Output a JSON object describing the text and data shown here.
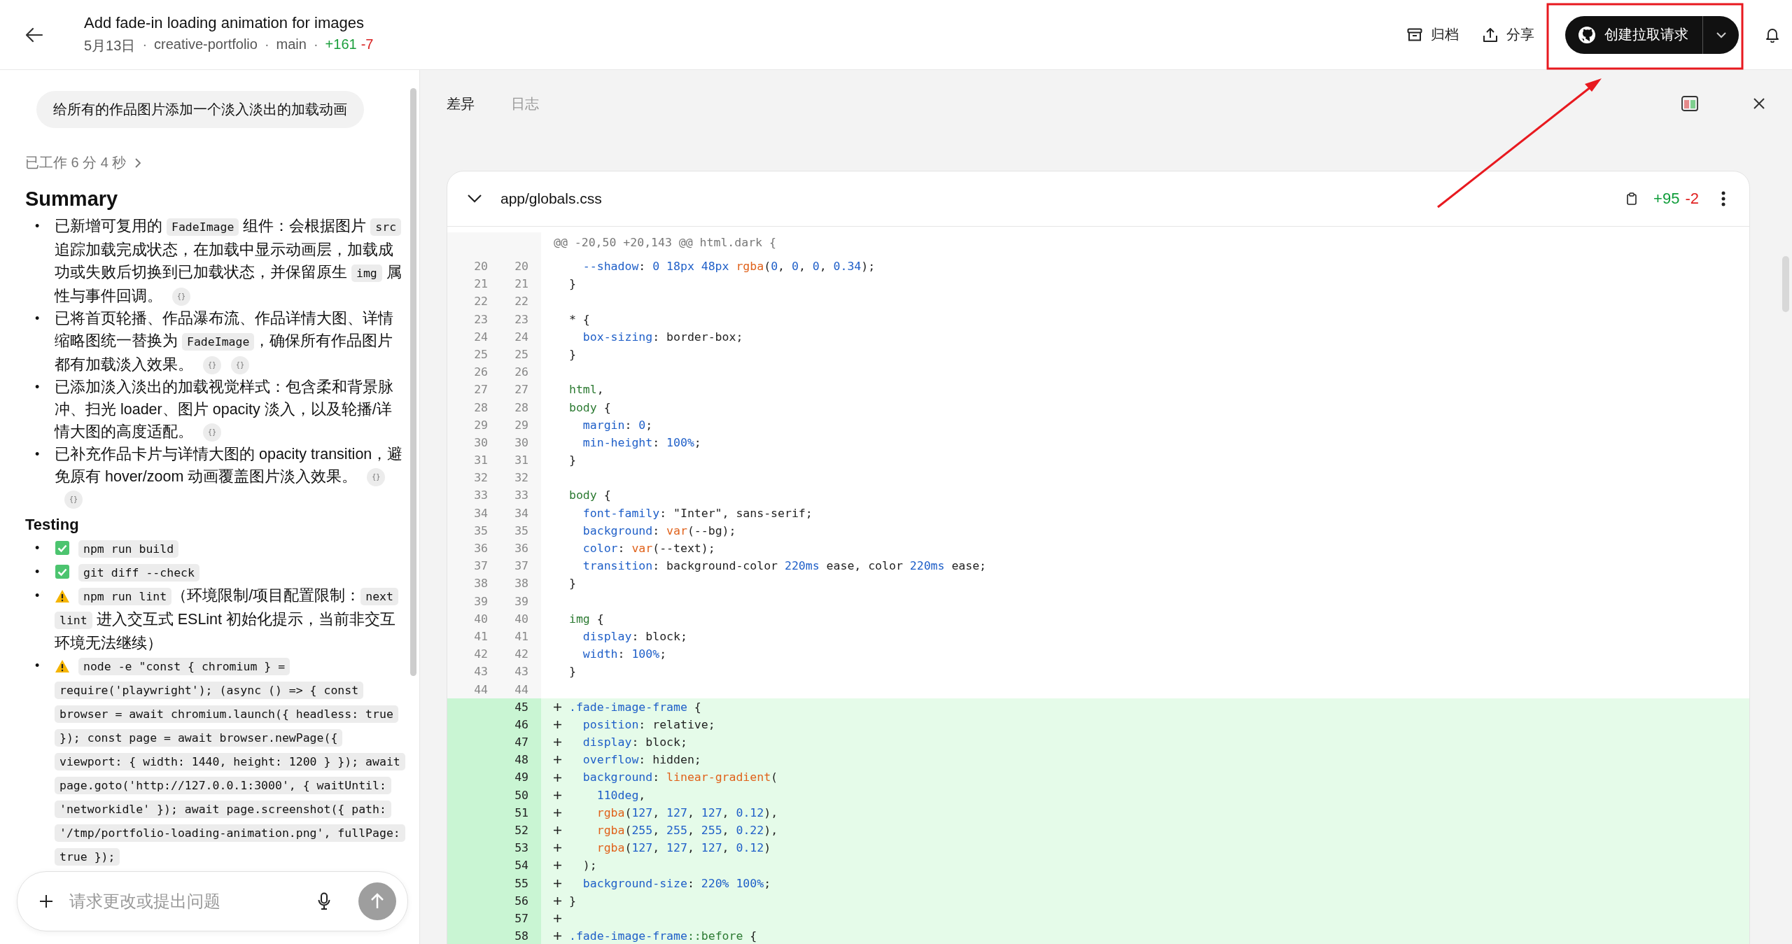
{
  "header": {
    "title": "Add fade-in loading animation for images",
    "meta": [
      {
        "kind": "text",
        "text": "5月13日"
      },
      {
        "kind": "sep",
        "text": "·"
      },
      {
        "kind": "text",
        "text": "creative-portfolio"
      },
      {
        "kind": "sep",
        "text": "·"
      },
      {
        "kind": "text",
        "text": "main"
      },
      {
        "kind": "sep",
        "text": "·"
      },
      {
        "kind": "add",
        "text": "+161"
      },
      {
        "kind": "del",
        "text": "-7"
      }
    ],
    "actions": [
      {
        "kind": "archive",
        "label": "归档"
      },
      {
        "kind": "share",
        "label": "分享"
      }
    ],
    "primary_action": {
      "label": "创建拉取请求"
    }
  },
  "conversation": {
    "prompt": "给所有的作品图片添加一个淡入淡出的加载动画",
    "worked": "已工作 6 分 4 秒",
    "summary": {
      "heading": "Summary",
      "items": [
        {
          "bullet": "•",
          "segments": [
            {
              "kind": "text",
              "text": "已新增可复用的 "
            },
            {
              "kind": "code",
              "text": "FadeImage"
            },
            {
              "kind": "text",
              "text": " 组件：会根据图片 "
            },
            {
              "kind": "code",
              "text": "src"
            },
            {
              "kind": "text",
              "text": " 追踪加载完成状态，在加载中显示动画层，加载成功或失败后切换到已加载状态，并保留原生 "
            },
            {
              "kind": "code",
              "text": "img"
            },
            {
              "kind": "text",
              "text": " 属性与事件回调。"
            },
            {
              "kind": "ref",
              "text": "{}"
            }
          ]
        },
        {
          "bullet": "•",
          "segments": [
            {
              "kind": "text",
              "text": "已将首页轮播、作品瀑布流、作品详情大图、详情缩略图统一替换为 "
            },
            {
              "kind": "code",
              "text": "FadeImage"
            },
            {
              "kind": "text",
              "text": "，确保所有作品图片都有加载淡入效果。"
            },
            {
              "kind": "ref",
              "text": "{}"
            },
            {
              "kind": "ref",
              "text": "{}"
            }
          ]
        },
        {
          "bullet": "•",
          "segments": [
            {
              "kind": "text",
              "text": "已添加淡入淡出的加载视觉样式：包含柔和背景脉冲、扫光 loader、图片 opacity 淡入，以及轮播/详情大图的高度适配。"
            },
            {
              "kind": "ref",
              "text": "{}"
            }
          ]
        },
        {
          "bullet": "•",
          "segments": [
            {
              "kind": "text",
              "text": "已补充作品卡片与详情大图的 opacity transition，避免原有 hover/zoom 动画覆盖图片淡入效果。"
            },
            {
              "kind": "ref",
              "text": "{}"
            },
            {
              "kind": "ref",
              "text": "{}"
            }
          ]
        }
      ]
    },
    "testing": {
      "heading": "Testing",
      "items": [
        {
          "bullet": "•",
          "kind": "passed",
          "segments": [
            {
              "kind": "code",
              "text": "npm run build"
            }
          ]
        },
        {
          "bullet": "•",
          "kind": "passed",
          "segments": [
            {
              "kind": "code",
              "text": "git diff --check"
            }
          ]
        },
        {
          "bullet": "•",
          "kind": "warning",
          "segments": [
            {
              "kind": "code",
              "text": "npm run lint"
            },
            {
              "kind": "text",
              "text": "（环境限制/项目配置限制："
            },
            {
              "kind": "code",
              "text": "next lint"
            },
            {
              "kind": "text",
              "text": " 进入交互式 ESLint 初始化提示，当前非交互环境无法继续）"
            }
          ]
        },
        {
          "bullet": "•",
          "kind": "warning",
          "segments": [
            {
              "kind": "code",
              "text": "node -e \"const { chromium } = require('playwright'); (async () => { const browser = await chromium.launch({ headless: true }); const page = await browser.newPage({ viewport: { width: 1440, height: 1200 } }); await page.goto('http://127.0.0.1:3000', { waitUntil: 'networkidle' }); await page.screenshot({ path: '/tmp/portfolio-loading-animation.png', fullPage: true });"
            }
          ]
        }
      ]
    }
  },
  "composer": {
    "placeholder": "请求更改或提出问题"
  },
  "diff_panel": {
    "tabs": [
      {
        "label": "差异",
        "selected": true
      },
      {
        "label": "日志",
        "selected": false
      }
    ],
    "file": {
      "path": "app/globals.css",
      "expanded": true,
      "additions": "+95",
      "deletions": "-2",
      "lines": [
        {
          "kind": "hunk",
          "tokens": [
            {
              "kind": "hunk",
              "text": "@@ -20,50 +20,143 @@ html.dark {"
            }
          ]
        },
        {
          "kind": "context",
          "old": "20",
          "new": "20",
          "tokens": [
            {
              "kind": "prop",
              "text": "  --shadow"
            },
            {
              "kind": "plain",
              "text": ": "
            },
            {
              "kind": "num",
              "text": "0 18px 48px "
            },
            {
              "kind": "func",
              "text": "rgba"
            },
            {
              "kind": "plain",
              "text": "("
            },
            {
              "kind": "num",
              "text": "0"
            },
            {
              "kind": "plain",
              "text": ", "
            },
            {
              "kind": "num",
              "text": "0"
            },
            {
              "kind": "plain",
              "text": ", "
            },
            {
              "kind": "num",
              "text": "0"
            },
            {
              "kind": "plain",
              "text": ", "
            },
            {
              "kind": "num",
              "text": "0.34"
            },
            {
              "kind": "plain",
              "text": ");"
            }
          ]
        },
        {
          "kind": "context",
          "old": "21",
          "new": "21",
          "tokens": [
            {
              "kind": "plain",
              "text": "}"
            }
          ]
        },
        {
          "kind": "context",
          "old": "22",
          "new": "22"
        },
        {
          "kind": "context",
          "old": "23",
          "new": "23",
          "tokens": [
            {
              "kind": "plain",
              "text": "* {"
            }
          ]
        },
        {
          "kind": "context",
          "old": "24",
          "new": "24",
          "tokens": [
            {
              "kind": "prop",
              "text": "  box-sizing"
            },
            {
              "kind": "plain",
              "text": ": border-box;"
            }
          ]
        },
        {
          "kind": "context",
          "old": "25",
          "new": "25",
          "tokens": [
            {
              "kind": "plain",
              "text": "}"
            }
          ]
        },
        {
          "kind": "context",
          "old": "26",
          "new": "26"
        },
        {
          "kind": "context",
          "old": "27",
          "new": "27",
          "tokens": [
            {
              "kind": "tag",
              "text": "html"
            },
            {
              "kind": "plain",
              "text": ","
            }
          ]
        },
        {
          "kind": "context",
          "old": "28",
          "new": "28",
          "tokens": [
            {
              "kind": "tag",
              "text": "body"
            },
            {
              "kind": "plain",
              "text": " {"
            }
          ]
        },
        {
          "kind": "context",
          "old": "29",
          "new": "29",
          "tokens": [
            {
              "kind": "prop",
              "text": "  margin"
            },
            {
              "kind": "plain",
              "text": ": "
            },
            {
              "kind": "num",
              "text": "0"
            },
            {
              "kind": "plain",
              "text": ";"
            }
          ]
        },
        {
          "kind": "context",
          "old": "30",
          "new": "30",
          "tokens": [
            {
              "kind": "prop",
              "text": "  min-height"
            },
            {
              "kind": "plain",
              "text": ": "
            },
            {
              "kind": "num",
              "text": "100%"
            },
            {
              "kind": "plain",
              "text": ";"
            }
          ]
        },
        {
          "kind": "context",
          "old": "31",
          "new": "31",
          "tokens": [
            {
              "kind": "plain",
              "text": "}"
            }
          ]
        },
        {
          "kind": "context",
          "old": "32",
          "new": "32"
        },
        {
          "kind": "context",
          "old": "33",
          "new": "33",
          "tokens": [
            {
              "kind": "tag",
              "text": "body"
            },
            {
              "kind": "plain",
              "text": " {"
            }
          ]
        },
        {
          "kind": "context",
          "old": "34",
          "new": "34",
          "tokens": [
            {
              "kind": "prop",
              "text": "  font-family"
            },
            {
              "kind": "plain",
              "text": ": \"Inter\", sans-serif;"
            }
          ]
        },
        {
          "kind": "context",
          "old": "35",
          "new": "35",
          "tokens": [
            {
              "kind": "prop",
              "text": "  background"
            },
            {
              "kind": "plain",
              "text": ": "
            },
            {
              "kind": "func",
              "text": "var"
            },
            {
              "kind": "plain",
              "text": "(--bg);"
            }
          ]
        },
        {
          "kind": "context",
          "old": "36",
          "new": "36",
          "tokens": [
            {
              "kind": "prop",
              "text": "  color"
            },
            {
              "kind": "plain",
              "text": ": "
            },
            {
              "kind": "func",
              "text": "var"
            },
            {
              "kind": "plain",
              "text": "(--text);"
            }
          ]
        },
        {
          "kind": "context",
          "old": "37",
          "new": "37",
          "tokens": [
            {
              "kind": "prop",
              "text": "  transition"
            },
            {
              "kind": "plain",
              "text": ": background-color "
            },
            {
              "kind": "num",
              "text": "220ms"
            },
            {
              "kind": "plain",
              "text": " ease, color "
            },
            {
              "kind": "num",
              "text": "220ms"
            },
            {
              "kind": "plain",
              "text": " ease;"
            }
          ]
        },
        {
          "kind": "context",
          "old": "38",
          "new": "38",
          "tokens": [
            {
              "kind": "plain",
              "text": "}"
            }
          ]
        },
        {
          "kind": "context",
          "old": "39",
          "new": "39"
        },
        {
          "kind": "context",
          "old": "40",
          "new": "40",
          "tokens": [
            {
              "kind": "tag",
              "text": "img"
            },
            {
              "kind": "plain",
              "text": " {"
            }
          ]
        },
        {
          "kind": "context",
          "old": "41",
          "new": "41",
          "tokens": [
            {
              "kind": "prop",
              "text": "  display"
            },
            {
              "kind": "plain",
              "text": ": block;"
            }
          ]
        },
        {
          "kind": "context",
          "old": "42",
          "new": "42",
          "tokens": [
            {
              "kind": "prop",
              "text": "  width"
            },
            {
              "kind": "plain",
              "text": ": "
            },
            {
              "kind": "num",
              "text": "100%"
            },
            {
              "kind": "plain",
              "text": ";"
            }
          ]
        },
        {
          "kind": "context",
          "old": "43",
          "new": "43",
          "tokens": [
            {
              "kind": "plain",
              "text": "}"
            }
          ]
        },
        {
          "kind": "context",
          "old": "44",
          "new": "44"
        },
        {
          "kind": "added",
          "new": "45",
          "tokens": [
            {
              "kind": "prop",
              "text": ".fade-image-frame"
            },
            {
              "kind": "plain",
              "text": " {"
            }
          ]
        },
        {
          "kind": "added",
          "new": "46",
          "tokens": [
            {
              "kind": "prop",
              "text": "  position"
            },
            {
              "kind": "plain",
              "text": ": relative;"
            }
          ]
        },
        {
          "kind": "added",
          "new": "47",
          "tokens": [
            {
              "kind": "prop",
              "text": "  display"
            },
            {
              "kind": "plain",
              "text": ": block;"
            }
          ]
        },
        {
          "kind": "added",
          "new": "48",
          "tokens": [
            {
              "kind": "prop",
              "text": "  overflow"
            },
            {
              "kind": "plain",
              "text": ": hidden;"
            }
          ]
        },
        {
          "kind": "added",
          "new": "49",
          "tokens": [
            {
              "kind": "prop",
              "text": "  background"
            },
            {
              "kind": "plain",
              "text": ": "
            },
            {
              "kind": "func",
              "text": "linear-gradient"
            },
            {
              "kind": "plain",
              "text": "("
            }
          ]
        },
        {
          "kind": "added",
          "new": "50",
          "tokens": [
            {
              "kind": "num",
              "text": "    110deg"
            },
            {
              "kind": "plain",
              "text": ","
            }
          ]
        },
        {
          "kind": "added",
          "new": "51",
          "tokens": [
            {
              "kind": "func",
              "text": "    rgba"
            },
            {
              "kind": "plain",
              "text": "("
            },
            {
              "kind": "num",
              "text": "127"
            },
            {
              "kind": "plain",
              "text": ", "
            },
            {
              "kind": "num",
              "text": "127"
            },
            {
              "kind": "plain",
              "text": ", "
            },
            {
              "kind": "num",
              "text": "127"
            },
            {
              "kind": "plain",
              "text": ", "
            },
            {
              "kind": "num",
              "text": "0.12"
            },
            {
              "kind": "plain",
              "text": "),"
            }
          ]
        },
        {
          "kind": "added",
          "new": "52",
          "tokens": [
            {
              "kind": "func",
              "text": "    rgba"
            },
            {
              "kind": "plain",
              "text": "("
            },
            {
              "kind": "num",
              "text": "255"
            },
            {
              "kind": "plain",
              "text": ", "
            },
            {
              "kind": "num",
              "text": "255"
            },
            {
              "kind": "plain",
              "text": ", "
            },
            {
              "kind": "num",
              "text": "255"
            },
            {
              "kind": "plain",
              "text": ", "
            },
            {
              "kind": "num",
              "text": "0.22"
            },
            {
              "kind": "plain",
              "text": "),"
            }
          ]
        },
        {
          "kind": "added",
          "new": "53",
          "tokens": [
            {
              "kind": "func",
              "text": "    rgba"
            },
            {
              "kind": "plain",
              "text": "("
            },
            {
              "kind": "num",
              "text": "127"
            },
            {
              "kind": "plain",
              "text": ", "
            },
            {
              "kind": "num",
              "text": "127"
            },
            {
              "kind": "plain",
              "text": ", "
            },
            {
              "kind": "num",
              "text": "127"
            },
            {
              "kind": "plain",
              "text": ", "
            },
            {
              "kind": "num",
              "text": "0.12"
            },
            {
              "kind": "plain",
              "text": ")"
            }
          ]
        },
        {
          "kind": "added",
          "new": "54",
          "tokens": [
            {
              "kind": "plain",
              "text": "  );"
            }
          ]
        },
        {
          "kind": "added",
          "new": "55",
          "tokens": [
            {
              "kind": "prop",
              "text": "  background-size"
            },
            {
              "kind": "plain",
              "text": ": "
            },
            {
              "kind": "num",
              "text": "220% 100%"
            },
            {
              "kind": "plain",
              "text": ";"
            }
          ]
        },
        {
          "kind": "added",
          "new": "56",
          "tokens": [
            {
              "kind": "plain",
              "text": "}"
            }
          ]
        },
        {
          "kind": "added",
          "new": "57"
        },
        {
          "kind": "added",
          "new": "58",
          "tokens": [
            {
              "kind": "prop",
              "text": ".fade-image-frame"
            },
            {
              "kind": "tag",
              "text": "::before"
            },
            {
              "kind": "plain",
              "text": " {"
            }
          ]
        }
      ]
    }
  }
}
